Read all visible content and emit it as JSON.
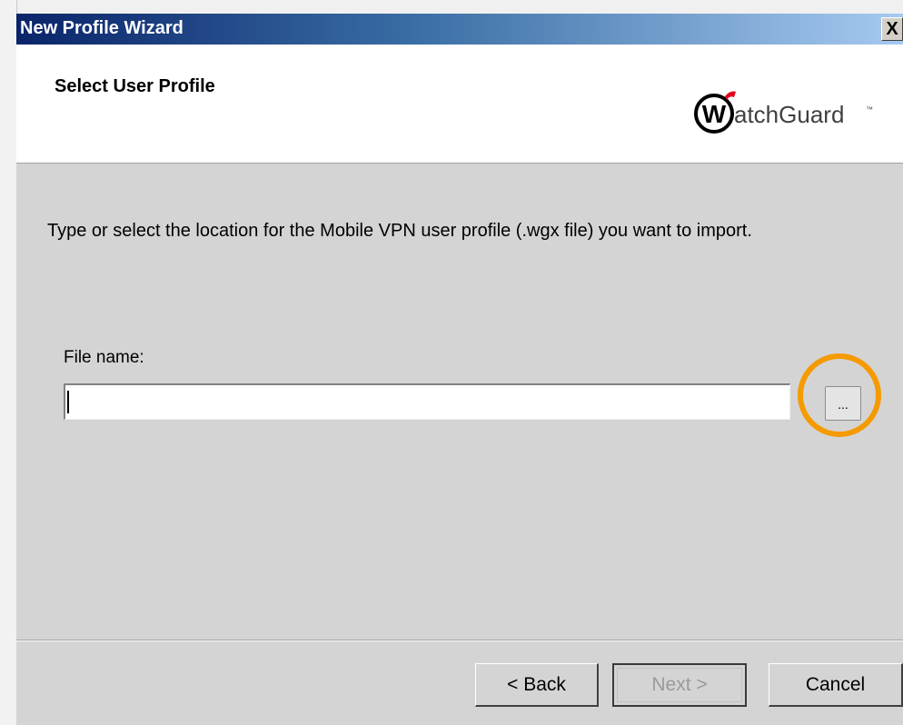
{
  "window": {
    "title": "New Profile Wizard",
    "close_label": "X"
  },
  "header": {
    "title": "Select User Profile",
    "brand": "WatchGuard"
  },
  "content": {
    "instruction": "Type or select the location for the Mobile VPN user profile (.wgx file) you want to import.",
    "file_label": "File name:",
    "file_value": "",
    "browse_label": "..."
  },
  "footer": {
    "back_label": "< Back",
    "next_label": "Next >",
    "cancel_label": "Cancel"
  },
  "colors": {
    "highlight": "#f59a00",
    "brand_red": "#e1001a"
  }
}
